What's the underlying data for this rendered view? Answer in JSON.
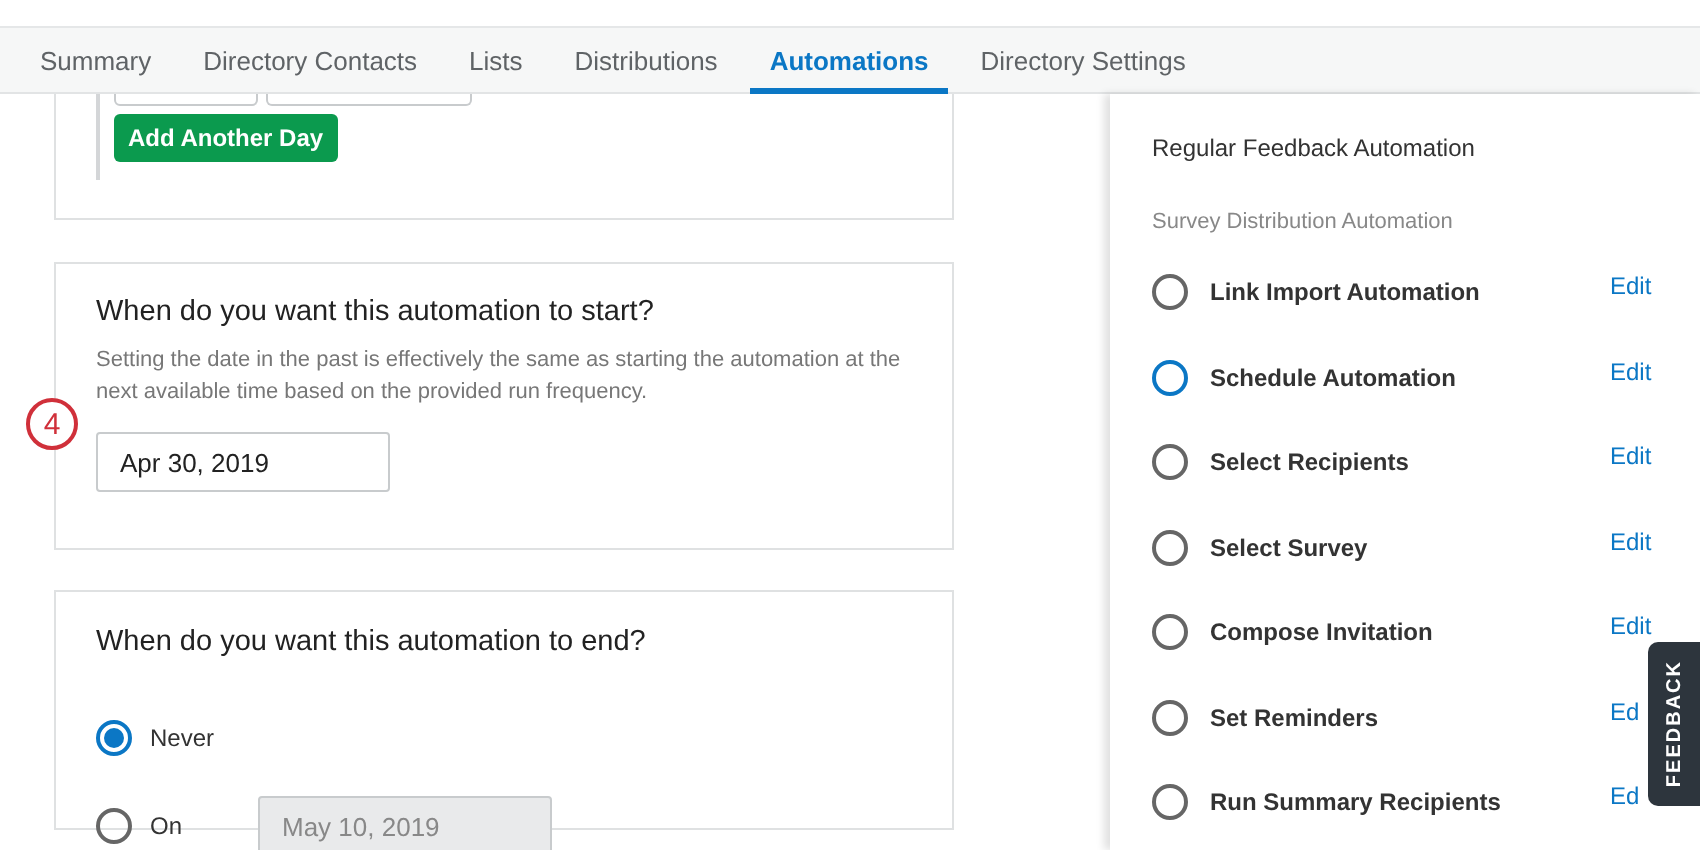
{
  "tabs": [
    {
      "label": "Summary",
      "selected": false
    },
    {
      "label": "Directory Contacts",
      "selected": false
    },
    {
      "label": "Lists",
      "selected": false
    },
    {
      "label": "Distributions",
      "selected": false
    },
    {
      "label": "Automations",
      "selected": true
    },
    {
      "label": "Directory Settings",
      "selected": false
    }
  ],
  "schedule_card": {
    "add_button": "Add Another Day"
  },
  "start_card": {
    "title": "When do you want this automation to start?",
    "description": "Setting the date in the past is effectively the same as starting the automation at the next available time based on the provided run frequency.",
    "date": "Apr 30, 2019",
    "step_badge": "4"
  },
  "end_card": {
    "title": "When do you want this automation to end?",
    "options": [
      {
        "label": "Never",
        "selected": true
      },
      {
        "label": "On",
        "selected": false,
        "date": "May 10, 2019",
        "disabled": true
      }
    ]
  },
  "panel": {
    "title": "Regular Feedback Automation",
    "subtitle": "Survey Distribution Automation",
    "steps": [
      {
        "label": "Link Import Automation",
        "selected": false,
        "action": "Edit"
      },
      {
        "label": "Schedule Automation",
        "selected": true,
        "action": "Edit"
      },
      {
        "label": "Select Recipients",
        "selected": false,
        "action": "Edit"
      },
      {
        "label": "Select Survey",
        "selected": false,
        "action": "Edit"
      },
      {
        "label": "Compose Invitation",
        "selected": false,
        "action": "Edit"
      },
      {
        "label": "Set Reminders",
        "selected": false,
        "action": "Ed"
      },
      {
        "label": "Run Summary Recipients",
        "selected": false,
        "action": "Ed"
      }
    ]
  },
  "feedback_tab": "FEEDBACK"
}
